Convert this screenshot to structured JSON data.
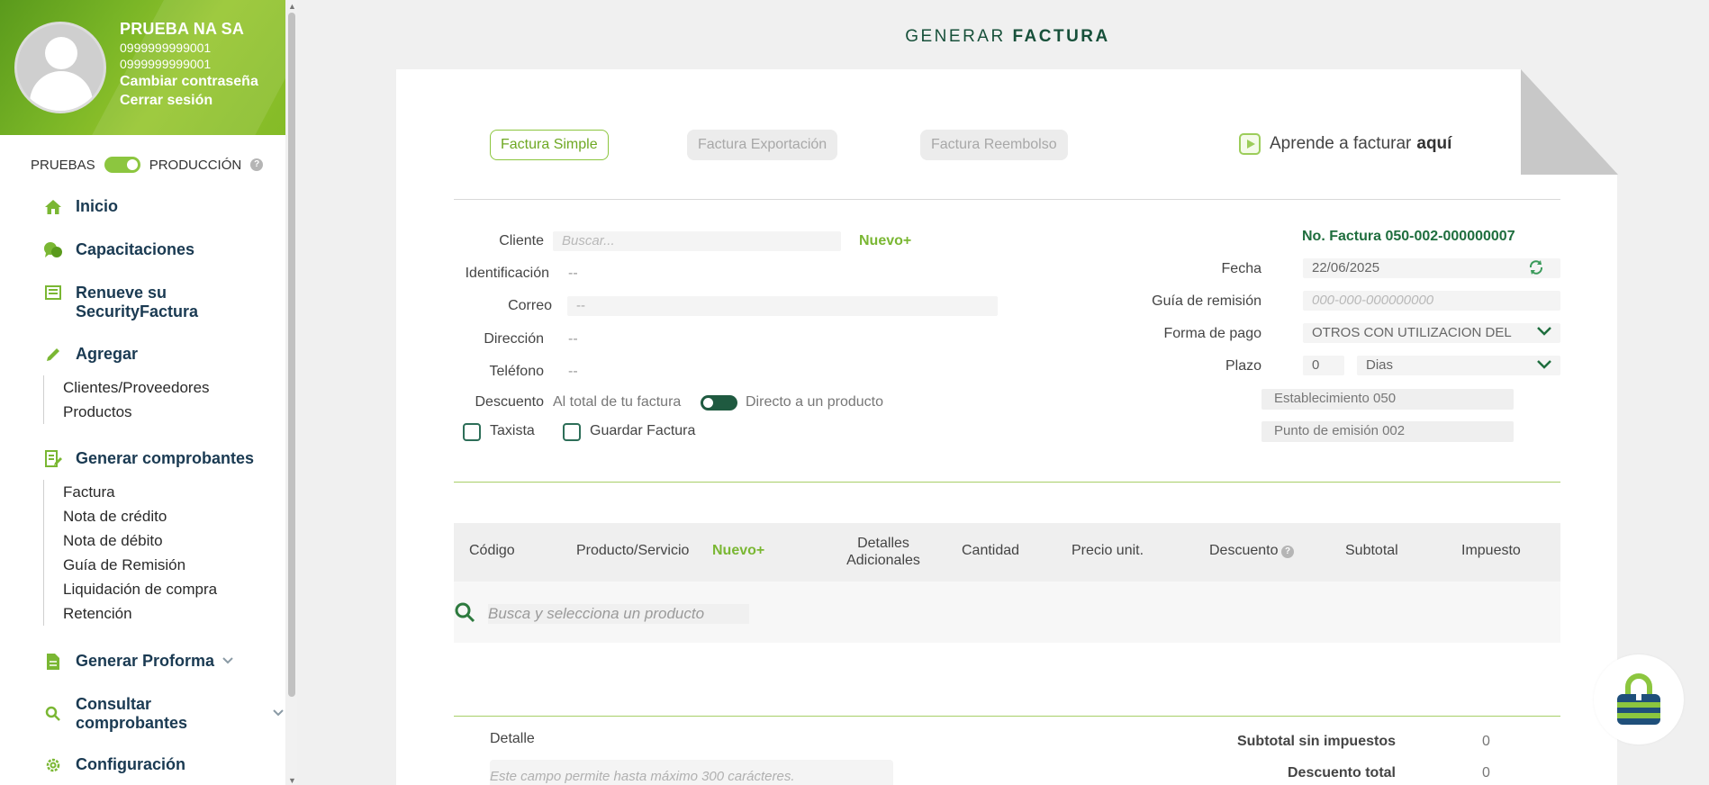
{
  "profile": {
    "name": "PRUEBA NA SA",
    "id1": "0999999999001",
    "id2": "0999999999001",
    "change_password": "Cambiar contraseña",
    "logout": "Cerrar sesión"
  },
  "environment": {
    "test_label": "PRUEBAS",
    "prod_label": "PRODUCCIÓN",
    "help": "?"
  },
  "nav": {
    "inicio": "Inicio",
    "capacitaciones": "Capacitaciones",
    "renueve_1": "Renueve su",
    "renueve_2": "SecurityFactura",
    "agregar": "Agregar",
    "agregar_sub": [
      "Clientes/Proveedores",
      "Productos"
    ],
    "generar_comprobantes": "Generar comprobantes",
    "comprobantes_sub": [
      "Factura",
      "Nota de crédito",
      "Nota de débito",
      "Guía de Remisión",
      "Liquidación de compra",
      "Retención"
    ],
    "generar_proforma": "Generar Proforma",
    "consultar_1": "Consultar",
    "consultar_2": "comprobantes",
    "configuracion": "Configuración"
  },
  "page": {
    "title_light": "GENERAR",
    "title_bold": "FACTURA"
  },
  "tabs": {
    "simple": "Factura Simple",
    "exportacion": "Factura Exportación",
    "reembolso": "Factura Reembolso"
  },
  "learn": {
    "text": "Aprende a facturar",
    "bold": "aquí"
  },
  "form": {
    "cliente_label": "Cliente",
    "cliente_placeholder": "Buscar...",
    "nuevo": "Nuevo+",
    "identificacion_label": "Identificación",
    "identificacion_value": "--",
    "correo_label": "Correo",
    "correo_value": "--",
    "direccion_label": "Dirección",
    "direccion_value": "--",
    "telefono_label": "Teléfono",
    "telefono_value": "--",
    "descuento_label": "Descuento",
    "descuento_total": "Al total de tu factura",
    "descuento_producto": "Directo a un producto",
    "taxista": "Taxista",
    "guardar_factura": "Guardar Factura"
  },
  "invoice": {
    "number_label": "No. Factura 050-002-000000007",
    "fecha_label": "Fecha",
    "fecha_value": "22/06/2025",
    "guia_label": "Guía de remisión",
    "guia_placeholder": "000-000-000000000",
    "forma_pago_label": "Forma de pago",
    "forma_pago_value": "OTROS CON UTILIZACION DEL",
    "plazo_label": "Plazo",
    "plazo_value": "0",
    "plazo_unit": "Dias",
    "establecimiento": "Establecimiento 050",
    "punto_emision": "Punto de emisión 002"
  },
  "table": {
    "codigo": "Código",
    "producto": "Producto/Servicio",
    "nuevo": "Nuevo+",
    "detalles_1": "Detalles",
    "detalles_2": "Adicionales",
    "cantidad": "Cantidad",
    "precio": "Precio unit.",
    "descuento": "Descuento",
    "subtotal": "Subtotal",
    "impuesto": "Impuesto",
    "search_placeholder": "Busca y selecciona un producto"
  },
  "footer": {
    "detalle_label": "Detalle",
    "detalle_placeholder": "Este campo permite hasta máximo 300 carácteres.",
    "subtotal_label": "Subtotal sin impuestos",
    "subtotal_value": "0",
    "descuento_label": "Descuento total",
    "descuento_value": "0"
  },
  "colors": {
    "brand_green": "#8cc63f",
    "dark_green": "#1f6e3e",
    "navy": "#1a3a52"
  }
}
